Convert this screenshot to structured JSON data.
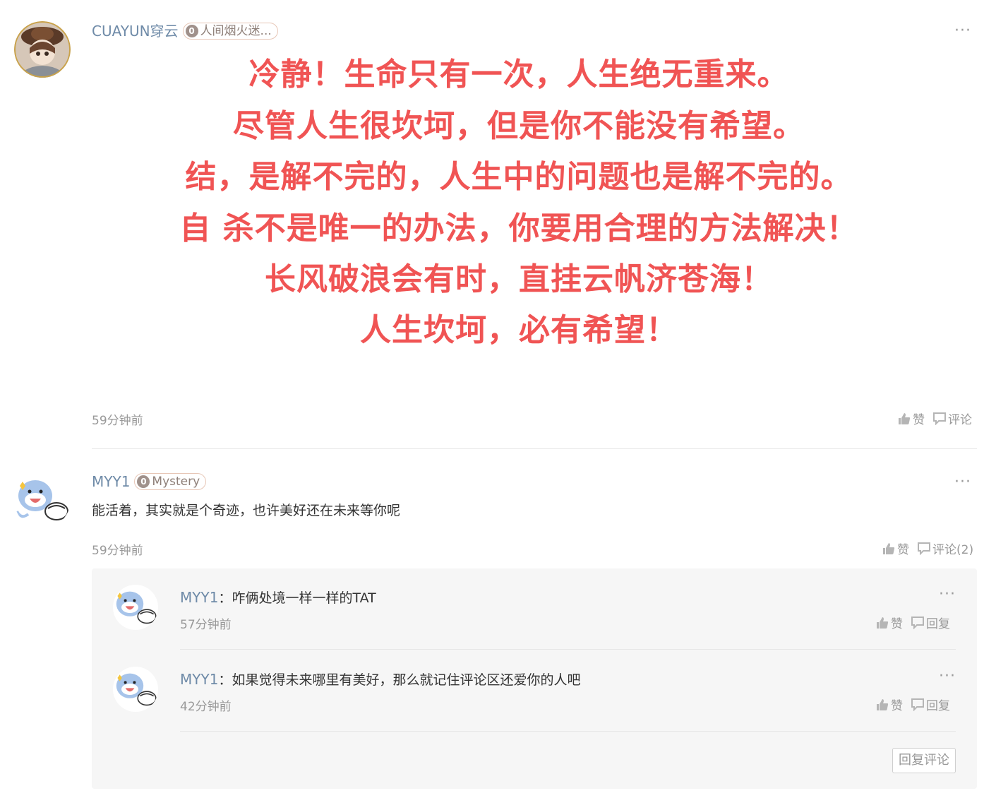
{
  "comment1": {
    "username": "CUAYUN穿云",
    "badge_level": "0",
    "badge_text": "人间烟火迷...",
    "lines": [
      "冷静！生命只有一次，人生绝无重来。",
      "尽管人生很坎坷，但是你不能没有希望。",
      "结，是解不完的，人生中的问题也是解不完的。",
      "自 杀不是唯一的办法，你要用合理的方法解决！",
      "长风破浪会有时，直挂云帆济苍海！",
      "人生坎坷，必有希望！"
    ],
    "time": "59分钟前",
    "like_label": "赞",
    "comment_label": "评论",
    "more": "···"
  },
  "comment2": {
    "username": "MYY1",
    "badge_level": "0",
    "badge_text": "Mystery",
    "text": "能活着，其实就是个奇迹，也许美好还在未来等你呢",
    "time": "59分钟前",
    "like_label": "赞",
    "comment_label": "评论(2)",
    "more": "···"
  },
  "replies": [
    {
      "username": "MYY1",
      "separator": "：",
      "text": "咋俩处境一样一样的TAT",
      "time": "57分钟前",
      "like_label": "赞",
      "reply_label": "回复",
      "more": "···"
    },
    {
      "username": "MYY1",
      "separator": "：",
      "text": "如果觉得未来哪里有美好，那么就记住评论区还爱你的人吧",
      "time": "42分钟前",
      "like_label": "赞",
      "reply_label": "回复",
      "more": "···"
    }
  ],
  "reply_comment_button": "回复评论",
  "colors": {
    "accent_red": "#f05454",
    "username_blue": "#6f8ba8",
    "muted": "#999999"
  }
}
